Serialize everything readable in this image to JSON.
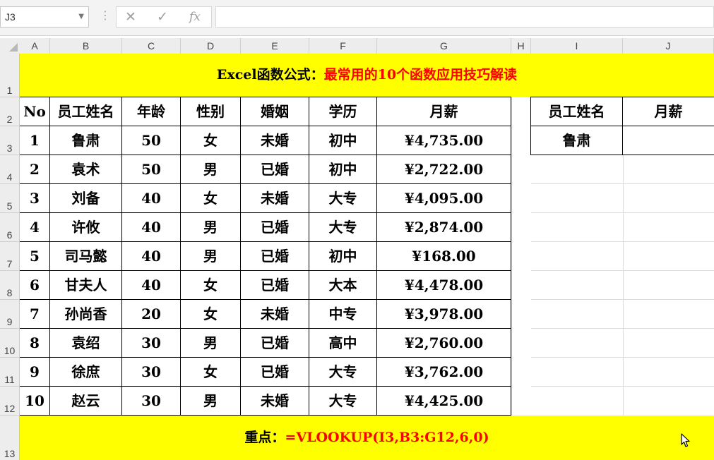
{
  "formula_bar": {
    "name_box": "J3",
    "cancel_icon": "✕",
    "enter_icon": "✓",
    "fx_label": "fx",
    "formula": ""
  },
  "columns": [
    "A",
    "B",
    "C",
    "D",
    "E",
    "F",
    "G",
    "H",
    "I",
    "J"
  ],
  "rows": [
    "1",
    "2",
    "3",
    "4",
    "5",
    "6",
    "7",
    "8",
    "9",
    "10",
    "11",
    "12",
    "13"
  ],
  "title_banner": {
    "part1": "Excel函数公式：",
    "part2": "最常用的10个函数应用技巧解读",
    "part1_color": "#000000",
    "part2_color": "#ff0000",
    "background": "#ffff00"
  },
  "table": {
    "headers": [
      "No",
      "员工姓名",
      "年龄",
      "性别",
      "婚姻",
      "学历",
      "月薪"
    ],
    "rows": [
      [
        "1",
        "鲁肃",
        "50",
        "女",
        "未婚",
        "初中",
        "¥4,735.00"
      ],
      [
        "2",
        "袁术",
        "50",
        "男",
        "已婚",
        "初中",
        "¥2,722.00"
      ],
      [
        "3",
        "刘备",
        "40",
        "女",
        "未婚",
        "大专",
        "¥4,095.00"
      ],
      [
        "4",
        "许攸",
        "40",
        "男",
        "已婚",
        "大专",
        "¥2,874.00"
      ],
      [
        "5",
        "司马懿",
        "40",
        "男",
        "已婚",
        "初中",
        "¥168.00"
      ],
      [
        "6",
        "甘夫人",
        "40",
        "女",
        "已婚",
        "大本",
        "¥4,478.00"
      ],
      [
        "7",
        "孙尚香",
        "20",
        "女",
        "未婚",
        "中专",
        "¥3,978.00"
      ],
      [
        "8",
        "袁绍",
        "30",
        "男",
        "已婚",
        "高中",
        "¥2,760.00"
      ],
      [
        "9",
        "徐庶",
        "30",
        "女",
        "已婚",
        "大专",
        "¥3,762.00"
      ],
      [
        "10",
        "赵云",
        "30",
        "男",
        "未婚",
        "大专",
        "¥4,425.00"
      ]
    ]
  },
  "lookup": {
    "headers": [
      "员工姓名",
      "月薪"
    ],
    "name": "鲁肃",
    "salary": ""
  },
  "note_banner": {
    "label": "重点：",
    "formula": "=VLOOKUP(I3,B3:G12,6,0)",
    "label_color": "#000000",
    "formula_color": "#ff0000"
  },
  "cursor_icon": "mouse-pointer-icon"
}
